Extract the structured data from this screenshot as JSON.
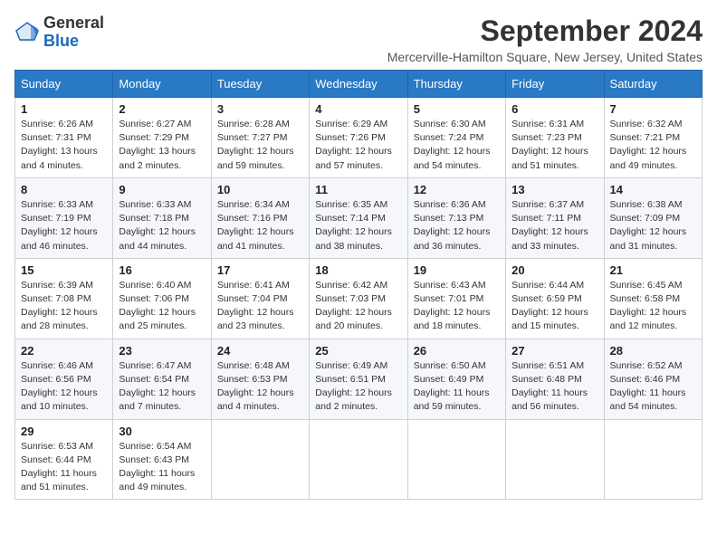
{
  "logo": {
    "general": "General",
    "blue": "Blue"
  },
  "title": "September 2024",
  "subtitle": "Mercerville-Hamilton Square, New Jersey, United States",
  "days_of_week": [
    "Sunday",
    "Monday",
    "Tuesday",
    "Wednesday",
    "Thursday",
    "Friday",
    "Saturday"
  ],
  "weeks": [
    [
      {
        "day": "1",
        "sunrise": "6:26 AM",
        "sunset": "7:31 PM",
        "daylight": "13 hours and 4 minutes."
      },
      {
        "day": "2",
        "sunrise": "6:27 AM",
        "sunset": "7:29 PM",
        "daylight": "13 hours and 2 minutes."
      },
      {
        "day": "3",
        "sunrise": "6:28 AM",
        "sunset": "7:27 PM",
        "daylight": "12 hours and 59 minutes."
      },
      {
        "day": "4",
        "sunrise": "6:29 AM",
        "sunset": "7:26 PM",
        "daylight": "12 hours and 57 minutes."
      },
      {
        "day": "5",
        "sunrise": "6:30 AM",
        "sunset": "7:24 PM",
        "daylight": "12 hours and 54 minutes."
      },
      {
        "day": "6",
        "sunrise": "6:31 AM",
        "sunset": "7:23 PM",
        "daylight": "12 hours and 51 minutes."
      },
      {
        "day": "7",
        "sunrise": "6:32 AM",
        "sunset": "7:21 PM",
        "daylight": "12 hours and 49 minutes."
      }
    ],
    [
      {
        "day": "8",
        "sunrise": "6:33 AM",
        "sunset": "7:19 PM",
        "daylight": "12 hours and 46 minutes."
      },
      {
        "day": "9",
        "sunrise": "6:33 AM",
        "sunset": "7:18 PM",
        "daylight": "12 hours and 44 minutes."
      },
      {
        "day": "10",
        "sunrise": "6:34 AM",
        "sunset": "7:16 PM",
        "daylight": "12 hours and 41 minutes."
      },
      {
        "day": "11",
        "sunrise": "6:35 AM",
        "sunset": "7:14 PM",
        "daylight": "12 hours and 38 minutes."
      },
      {
        "day": "12",
        "sunrise": "6:36 AM",
        "sunset": "7:13 PM",
        "daylight": "12 hours and 36 minutes."
      },
      {
        "day": "13",
        "sunrise": "6:37 AM",
        "sunset": "7:11 PM",
        "daylight": "12 hours and 33 minutes."
      },
      {
        "day": "14",
        "sunrise": "6:38 AM",
        "sunset": "7:09 PM",
        "daylight": "12 hours and 31 minutes."
      }
    ],
    [
      {
        "day": "15",
        "sunrise": "6:39 AM",
        "sunset": "7:08 PM",
        "daylight": "12 hours and 28 minutes."
      },
      {
        "day": "16",
        "sunrise": "6:40 AM",
        "sunset": "7:06 PM",
        "daylight": "12 hours and 25 minutes."
      },
      {
        "day": "17",
        "sunrise": "6:41 AM",
        "sunset": "7:04 PM",
        "daylight": "12 hours and 23 minutes."
      },
      {
        "day": "18",
        "sunrise": "6:42 AM",
        "sunset": "7:03 PM",
        "daylight": "12 hours and 20 minutes."
      },
      {
        "day": "19",
        "sunrise": "6:43 AM",
        "sunset": "7:01 PM",
        "daylight": "12 hours and 18 minutes."
      },
      {
        "day": "20",
        "sunrise": "6:44 AM",
        "sunset": "6:59 PM",
        "daylight": "12 hours and 15 minutes."
      },
      {
        "day": "21",
        "sunrise": "6:45 AM",
        "sunset": "6:58 PM",
        "daylight": "12 hours and 12 minutes."
      }
    ],
    [
      {
        "day": "22",
        "sunrise": "6:46 AM",
        "sunset": "6:56 PM",
        "daylight": "12 hours and 10 minutes."
      },
      {
        "day": "23",
        "sunrise": "6:47 AM",
        "sunset": "6:54 PM",
        "daylight": "12 hours and 7 minutes."
      },
      {
        "day": "24",
        "sunrise": "6:48 AM",
        "sunset": "6:53 PM",
        "daylight": "12 hours and 4 minutes."
      },
      {
        "day": "25",
        "sunrise": "6:49 AM",
        "sunset": "6:51 PM",
        "daylight": "12 hours and 2 minutes."
      },
      {
        "day": "26",
        "sunrise": "6:50 AM",
        "sunset": "6:49 PM",
        "daylight": "11 hours and 59 minutes."
      },
      {
        "day": "27",
        "sunrise": "6:51 AM",
        "sunset": "6:48 PM",
        "daylight": "11 hours and 56 minutes."
      },
      {
        "day": "28",
        "sunrise": "6:52 AM",
        "sunset": "6:46 PM",
        "daylight": "11 hours and 54 minutes."
      }
    ],
    [
      {
        "day": "29",
        "sunrise": "6:53 AM",
        "sunset": "6:44 PM",
        "daylight": "11 hours and 51 minutes."
      },
      {
        "day": "30",
        "sunrise": "6:54 AM",
        "sunset": "6:43 PM",
        "daylight": "11 hours and 49 minutes."
      },
      null,
      null,
      null,
      null,
      null
    ]
  ],
  "labels": {
    "sunrise": "Sunrise:",
    "sunset": "Sunset:",
    "daylight": "Daylight:"
  }
}
